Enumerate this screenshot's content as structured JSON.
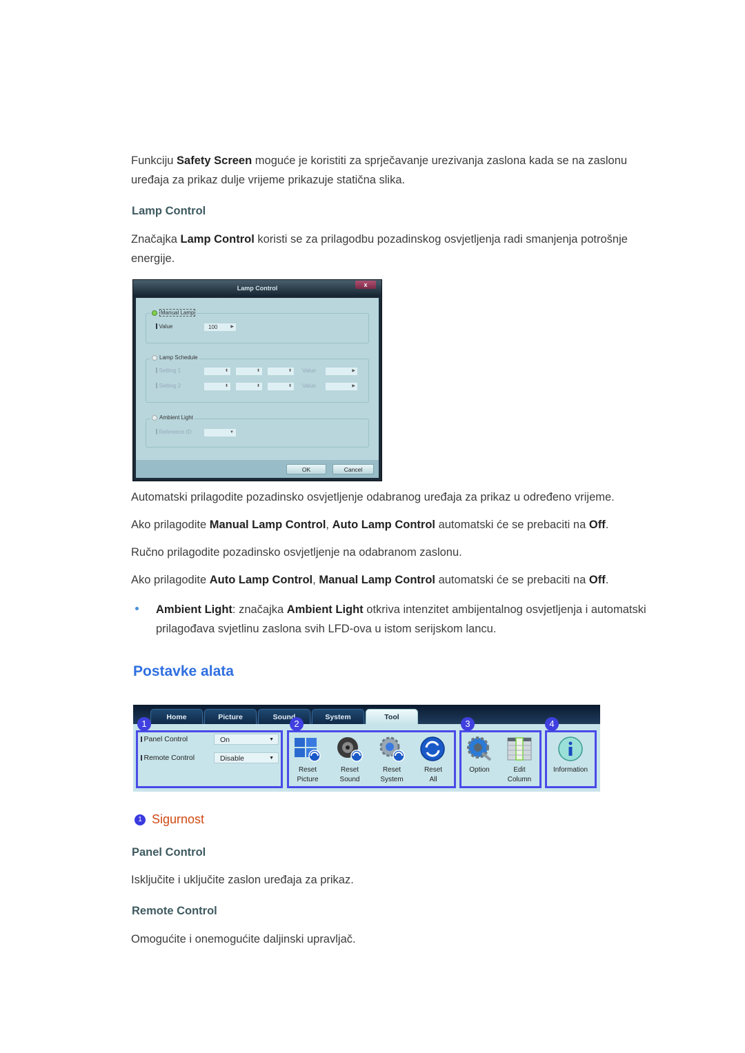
{
  "intro": {
    "p1_a": "Funkciju ",
    "p1_b": "Safety Screen",
    "p1_c": " moguće je koristiti za sprječavanje urezivanja zaslona kada se na zaslonu",
    "p1_d": "uređaja za prikaz dulje vrijeme prikazuje statična slika."
  },
  "lamp": {
    "heading": "Lamp Control",
    "p_a": "Značajka ",
    "p_b": "Lamp Control",
    "p_c": " koristi se za prilagodbu pozadinskog osvjetljenja radi smanjenja potrošnje",
    "p_d": "energije."
  },
  "dialog": {
    "title": "Lamp Control",
    "close": "x",
    "manual_lamp": "Manual Lamp",
    "value_label": "Value",
    "value": "100",
    "lamp_schedule": "Lamp Schedule",
    "setting1": "Setting 1",
    "setting2": "Setting 2",
    "value_col": "Value",
    "ambient_light": "Ambient Light",
    "reference_id": "Reference ID",
    "ok": "OK",
    "cancel": "Cancel"
  },
  "after": {
    "l1": "Automatski prilagodite pozadinsko osvjetljenje odabranog uređaja za prikaz u određeno vrijeme.",
    "l2_a": "Ako prilagodite ",
    "l2_b": "Manual Lamp Control",
    "l2_c": ", ",
    "l2_d": "Auto Lamp Control",
    "l2_e": " automatski će se prebaciti na ",
    "l2_f": "Off",
    "l2_g": ".",
    "l3": "Ručno prilagodite pozadinsko osvjetljenje na odabranom zaslonu.",
    "l4_a": "Ako prilagodite ",
    "l4_b": "Auto Lamp Control",
    "l4_c": ", ",
    "l4_d": "Manual Lamp Control",
    "l4_e": " automatski će se prebaciti na ",
    "l4_f": "Off",
    "l4_g": ".",
    "bullet_a": "Ambient Light",
    "bullet_b": ": značajka ",
    "bullet_c": "Ambient Light",
    "bullet_d": " otkriva intenzitet ambijentalnog osvjetljenja i automatski",
    "bullet_e": "prilagođava svjetlinu zaslona svih LFD-ova u istom serijskom lancu."
  },
  "tools": {
    "heading": "Postavke alata",
    "tabs": [
      "Home",
      "Picture",
      "Sound",
      "System",
      "Tool"
    ],
    "active_tab": "Tool",
    "numbers": [
      "1",
      "2",
      "3",
      "4"
    ],
    "panel_control_label": "Panel Control",
    "panel_control_value": "On",
    "remote_control_label": "Remote Control",
    "remote_control_value": "Disable",
    "buttons": [
      {
        "l1": "Reset",
        "l2": "Picture"
      },
      {
        "l1": "Reset",
        "l2": "Sound"
      },
      {
        "l1": "Reset",
        "l2": "System"
      },
      {
        "l1": "Reset",
        "l2": "All"
      },
      {
        "l1": "Option",
        "l2": ""
      },
      {
        "l1": "Edit",
        "l2": "Column"
      },
      {
        "l1": "Information",
        "l2": ""
      }
    ]
  },
  "security": {
    "badge": "1",
    "heading": "Sigurnost",
    "panel_heading": "Panel Control",
    "panel_text": "Isključite i uključite zaslon uređaja za prikaz.",
    "remote_heading": "Remote Control",
    "remote_text": "Omogućite i onemogućite daljinski upravljač."
  }
}
